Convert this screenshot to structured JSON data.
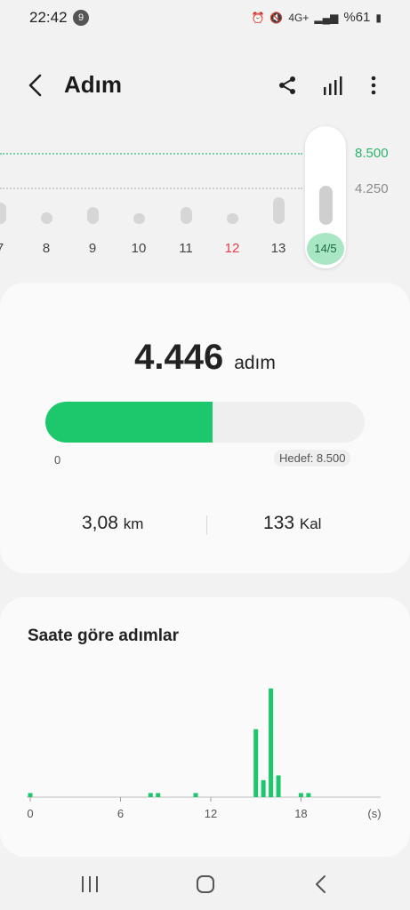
{
  "status_bar": {
    "time": "22:42",
    "notification_count": "9",
    "battery": "%61",
    "network": "4G+"
  },
  "header": {
    "title": "Adım"
  },
  "weekly": {
    "goal_label": "8.500",
    "half_label": "4.250",
    "days": [
      {
        "label": "7",
        "level": 0.3,
        "color": "#444444"
      },
      {
        "label": "8",
        "level": 0.16,
        "color": "#444444"
      },
      {
        "label": "9",
        "level": 0.24,
        "color": "#444444"
      },
      {
        "label": "10",
        "level": 0.1,
        "color": "#444444"
      },
      {
        "label": "11",
        "level": 0.24,
        "color": "#444444"
      },
      {
        "label": "12",
        "level": 0.1,
        "color": "#e0414a"
      },
      {
        "label": "13",
        "level": 0.38,
        "color": "#444444"
      }
    ],
    "selected": {
      "label": "14/5",
      "level": 0.52
    }
  },
  "summary": {
    "steps": "4.446",
    "steps_unit": "adım",
    "progress": 0.523,
    "min_label": "0",
    "goal_text": "Hedef: 8.500",
    "distance": "3,08",
    "distance_unit": "km",
    "calories": "133",
    "calories_unit": "Kal"
  },
  "hourly": {
    "title": "Saate göre adımlar",
    "x_ticks": [
      "0",
      "6",
      "12",
      "18"
    ],
    "x_unit": "(s)"
  },
  "chart_data": {
    "type": "bar",
    "title": "Saate göre adımlar",
    "xlabel": "(s)",
    "x": [
      0,
      8,
      8.5,
      11,
      15,
      15.5,
      16,
      16.5,
      18,
      18.5
    ],
    "values": [
      60,
      60,
      60,
      60,
      1000,
      250,
      1600,
      320,
      60,
      60
    ],
    "xlim": [
      0,
      23
    ],
    "ylim": [
      0,
      1700
    ],
    "color": "#1dc86c"
  },
  "colors": {
    "accent": "#1dc86c",
    "sunday": "#e0414a"
  }
}
